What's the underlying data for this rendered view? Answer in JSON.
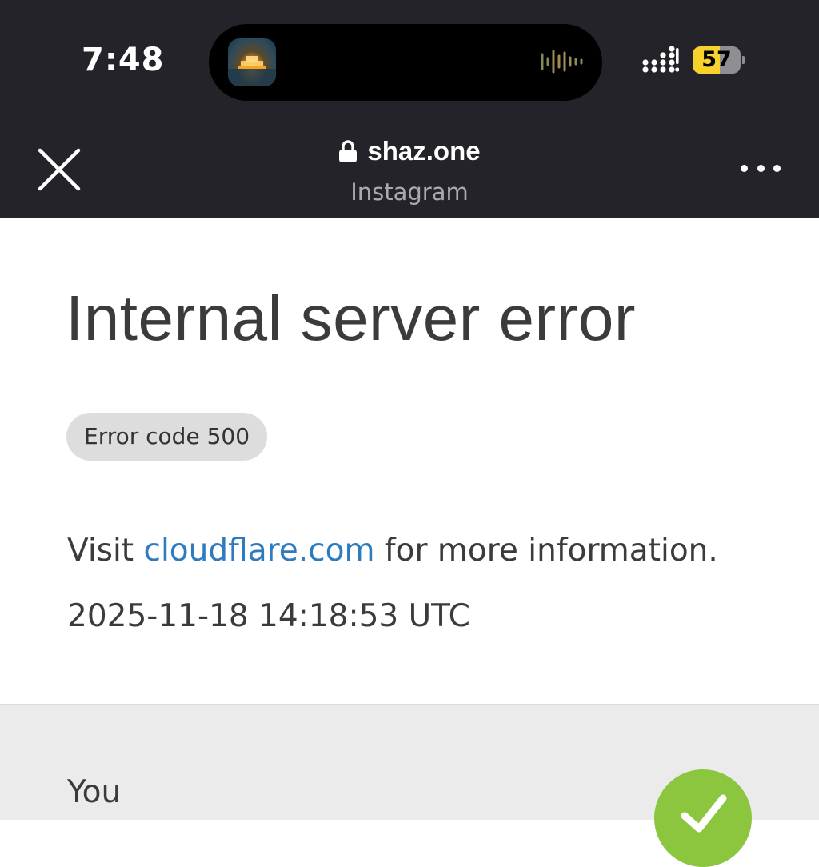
{
  "status_bar": {
    "time": "7:48",
    "battery_level": "57",
    "battery_fraction": 0.57,
    "signal_bars": 4,
    "now_playing_icon": "audio-waveform-icon",
    "accent_battery": "#f7d22d"
  },
  "browser": {
    "domain": "shaz.one",
    "source_app": "Instagram",
    "lock_icon": "lock-icon",
    "close_icon": "close-icon",
    "more_icon": "more-horizontal-icon"
  },
  "page": {
    "title": "Internal server error",
    "error_badge": "Error code 500",
    "visit_prefix": "Visit ",
    "visit_link": "cloudflare.com",
    "visit_suffix": " for more information.",
    "timestamp": "2025-11-18 14:18:53 UTC",
    "link_color": "#2f7bbf"
  },
  "status_section": {
    "label": "You",
    "status_icon": "check-icon",
    "status_color": "#8cc63f"
  }
}
